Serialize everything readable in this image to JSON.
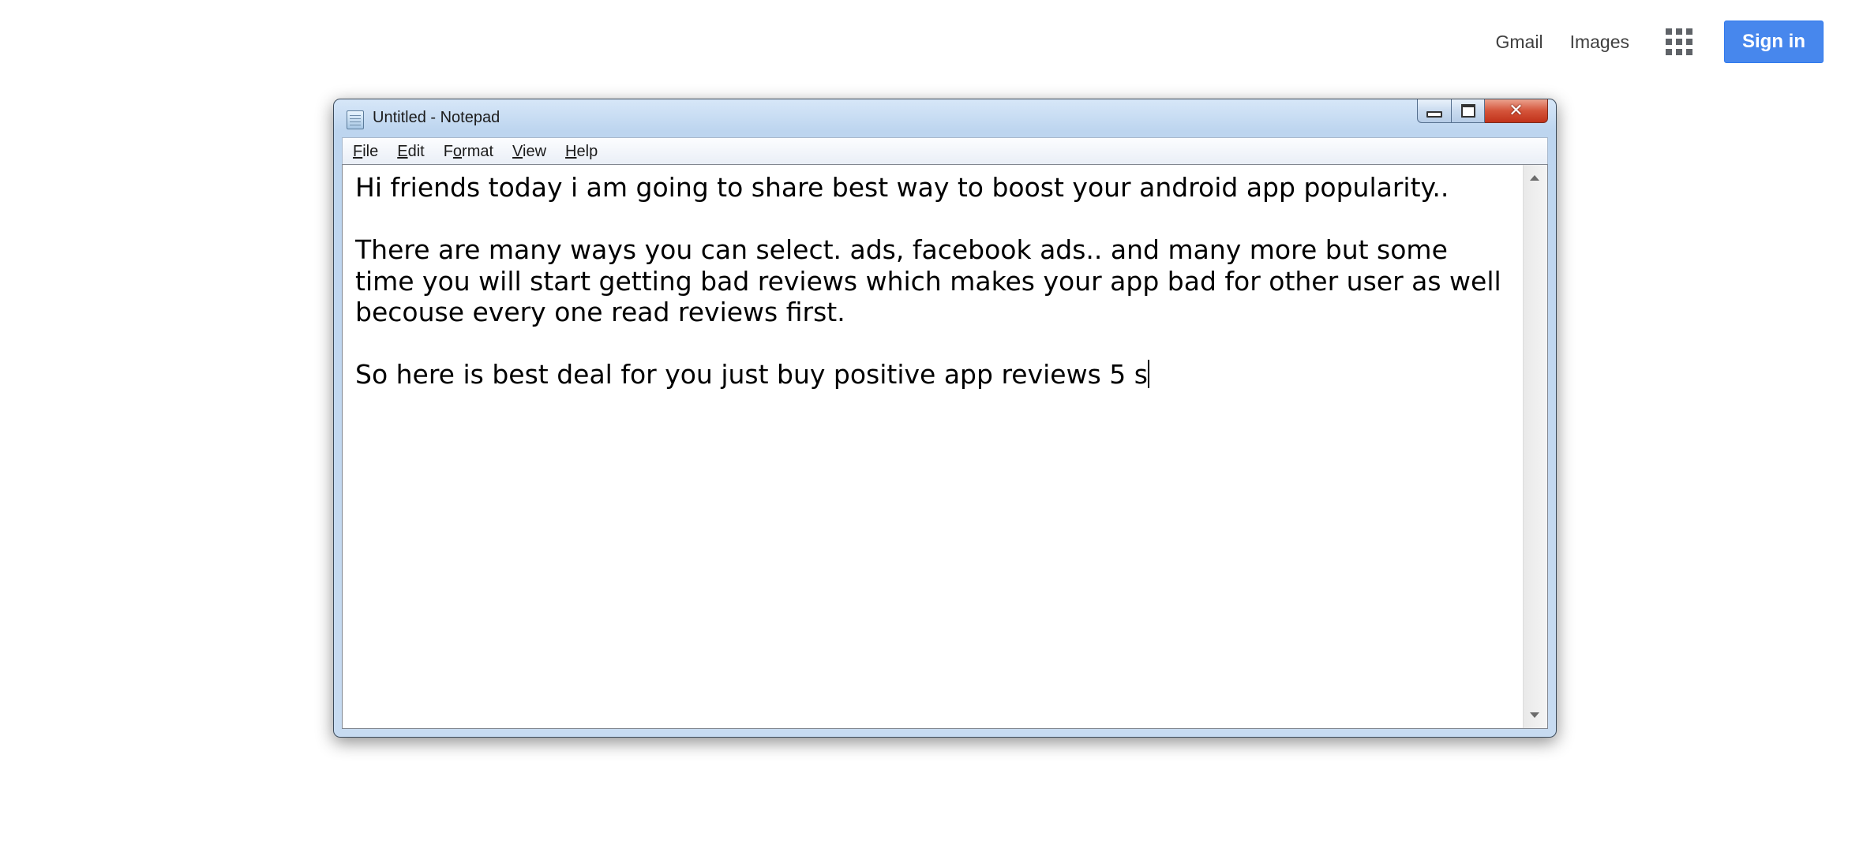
{
  "topbar": {
    "gmail": "Gmail",
    "images": "Images",
    "apps_icon": "apps-grid-icon",
    "signin": "Sign in"
  },
  "window": {
    "title": "Untitled - Notepad",
    "menu": [
      {
        "key": "F",
        "rest": "ile"
      },
      {
        "key": "E",
        "rest": "dit"
      },
      {
        "key": "",
        "pre": "F",
        "key2": "o",
        "rest": "rmat"
      },
      {
        "key": "V",
        "rest": "iew"
      },
      {
        "key": "H",
        "rest": "elp"
      }
    ],
    "controls": {
      "minimize": "minimize",
      "maximize": "maximize",
      "close": "close"
    }
  },
  "document": {
    "text": "Hi friends today i am going to share best way to boost your android app popularity..\n\nThere are many ways you can select. ads, facebook ads.. and many more but some time you will start getting bad reviews which makes your app bad for other user as well becouse every one read reviews first.\n\nSo here is best deal for you just buy positive app reviews 5 s"
  }
}
